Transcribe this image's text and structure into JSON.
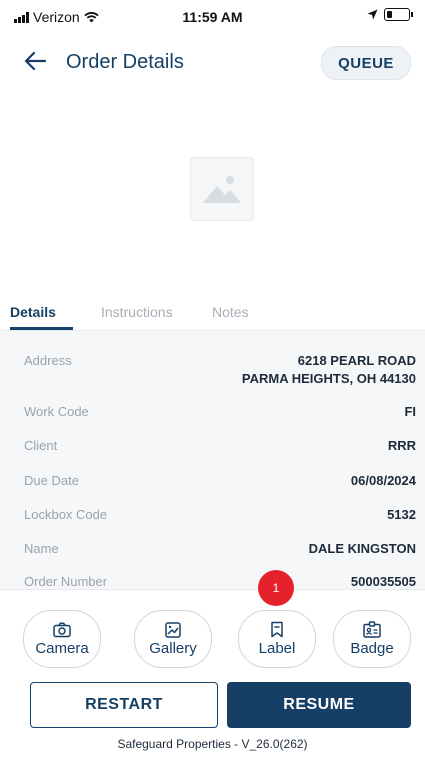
{
  "status_bar": {
    "carrier": "Verizon",
    "time": "11:59 AM"
  },
  "header": {
    "title": "Order Details",
    "queue_label": "QUEUE"
  },
  "tabs": [
    {
      "label": "Details",
      "active": true
    },
    {
      "label": "Instructions",
      "active": false
    },
    {
      "label": "Notes",
      "active": false
    }
  ],
  "details": [
    {
      "label": "Address",
      "value_line1": "6218 PEARL ROAD",
      "value_line2": "PARMA HEIGHTS, OH 44130"
    },
    {
      "label": "Work Code",
      "value": "FI"
    },
    {
      "label": "Client",
      "value": "RRR"
    },
    {
      "label": "Due Date",
      "value": "06/08/2024"
    },
    {
      "label": "Lockbox Code",
      "value": "5132"
    },
    {
      "label": "Name",
      "value": "DALE KINGSTON"
    },
    {
      "label": "Order Number",
      "value": "500035505"
    }
  ],
  "actions": [
    {
      "label": "Camera",
      "icon": "camera-icon"
    },
    {
      "label": "Gallery",
      "icon": "gallery-icon"
    },
    {
      "label": "Label",
      "icon": "bookmark-icon"
    },
    {
      "label": "Badge",
      "icon": "badge-icon"
    }
  ],
  "label_badge_count": "1",
  "buttons": {
    "restart": "RESTART",
    "resume": "RESUME"
  },
  "footer": "Safeguard Properties - V_26.0(262)",
  "colors": {
    "primary": "#163f66",
    "badge": "#e5212b",
    "details_bg": "#f6f7f8"
  }
}
